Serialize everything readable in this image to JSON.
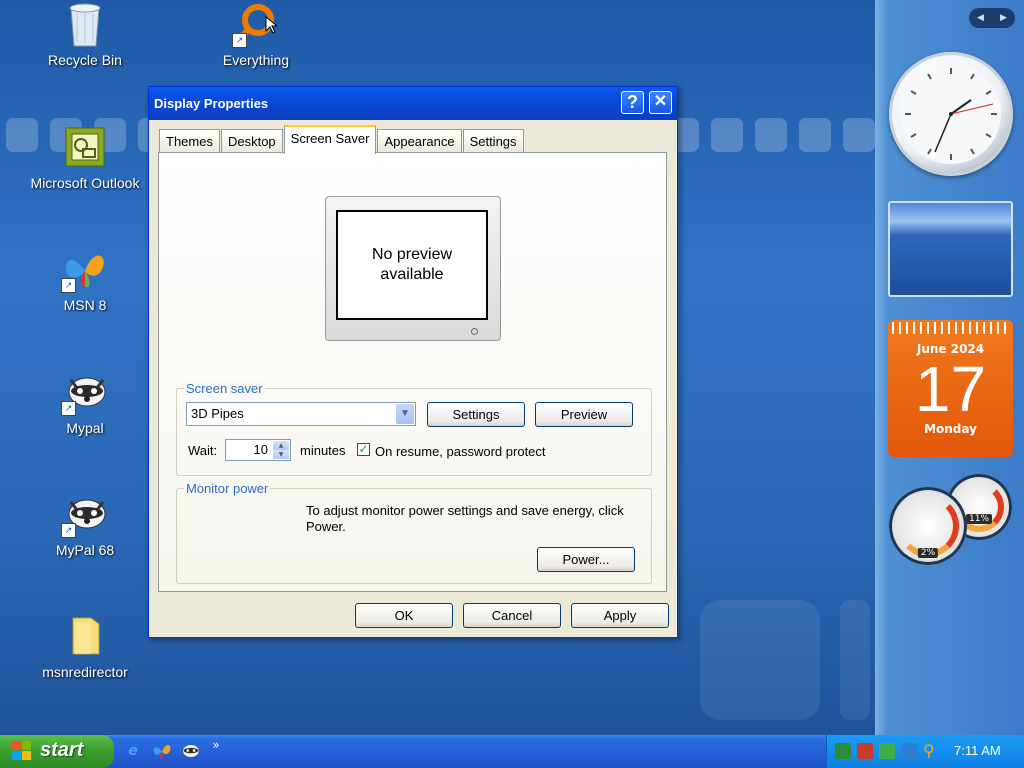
{
  "desktop": {
    "icons": [
      {
        "label": "Recycle Bin"
      },
      {
        "label": "Everything"
      },
      {
        "label": "Microsoft Outlook"
      },
      {
        "label": "MSN 8"
      },
      {
        "label": "Mypal"
      },
      {
        "label": "MyPal 68"
      },
      {
        "label": "msnredirector"
      }
    ]
  },
  "dialog": {
    "title": "Display Properties",
    "help_label": "?",
    "close_label": "✕",
    "tabs": [
      {
        "label": "Themes"
      },
      {
        "label": "Desktop"
      },
      {
        "label": "Screen Saver",
        "active": true
      },
      {
        "label": "Appearance"
      },
      {
        "label": "Settings"
      }
    ],
    "preview_text": "No preview available",
    "screen_saver": {
      "group_label": "Screen saver",
      "selected": "3D Pipes",
      "settings_button": "Settings",
      "preview_button": "Preview",
      "wait_label": "Wait:",
      "wait_value": "10",
      "minutes_label": "minutes",
      "password_label": "On resume, password protect",
      "password_checked": true
    },
    "monitor_power": {
      "group_label": "Monitor power",
      "description": "To adjust monitor power settings and save energy, click Power.",
      "power_button": "Power..."
    },
    "buttons": {
      "ok": "OK",
      "cancel": "Cancel",
      "apply": "Apply"
    }
  },
  "sidebar": {
    "calendar": {
      "month": "June 2024",
      "day": "17",
      "weekday": "Monday"
    },
    "cpu_meter": {
      "cpu": "2%",
      "memory": "11%"
    }
  },
  "taskbar": {
    "start_label": "start",
    "overflow": "»",
    "time": "7:11 AM"
  },
  "colors": {
    "accent_blue": "#0a5cf0",
    "start_green": "#3a9d2f",
    "calendar_orange": "#e2570b",
    "group_label_blue": "#2c6ec6"
  }
}
